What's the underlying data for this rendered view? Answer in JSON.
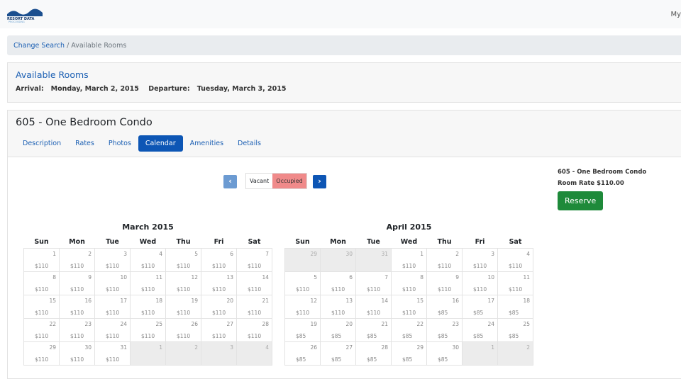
{
  "header": {
    "logo_text": "RESORT DATA PROCESSING",
    "user_menu": "My"
  },
  "breadcrumb": {
    "link": "Change Search",
    "current": "Available Rooms"
  },
  "available": {
    "title": "Available Rooms",
    "arrival_label": "Arrival:",
    "arrival": "Monday, March 2, 2015",
    "departure_label": "Departure:",
    "departure": "Tuesday, March 3, 2015"
  },
  "room": {
    "title": "605 - One Bedroom Condo",
    "tabs": [
      {
        "label": "Description"
      },
      {
        "label": "Rates"
      },
      {
        "label": "Photos"
      },
      {
        "label": "Calendar",
        "active": true
      },
      {
        "label": "Amenities"
      },
      {
        "label": "Details"
      }
    ]
  },
  "legend": {
    "vacant": "Vacant",
    "occupied": "Occupied",
    "occupied_color": "#f08a8a"
  },
  "side": {
    "room": "605 - One Bedroom Condo",
    "rate": "Room Rate $110.00",
    "reserve": "Reserve"
  },
  "weekdays": [
    "Sun",
    "Mon",
    "Tue",
    "Wed",
    "Thu",
    "Fri",
    "Sat"
  ],
  "calendars": [
    {
      "title": "March 2015",
      "weeks": [
        [
          [
            "1",
            "$110"
          ],
          [
            "2",
            "$110"
          ],
          [
            "3",
            "$110"
          ],
          [
            "4",
            "$110"
          ],
          [
            "5",
            "$110"
          ],
          [
            "6",
            "$110"
          ],
          [
            "7",
            "$110"
          ]
        ],
        [
          [
            "8",
            "$110"
          ],
          [
            "9",
            "$110"
          ],
          [
            "10",
            "$110"
          ],
          [
            "11",
            "$110"
          ],
          [
            "12",
            "$110"
          ],
          [
            "13",
            "$110"
          ],
          [
            "14",
            "$110"
          ]
        ],
        [
          [
            "15",
            "$110"
          ],
          [
            "16",
            "$110"
          ],
          [
            "17",
            "$110"
          ],
          [
            "18",
            "$110"
          ],
          [
            "19",
            "$110"
          ],
          [
            "20",
            "$110"
          ],
          [
            "21",
            "$110"
          ]
        ],
        [
          [
            "22",
            "$110"
          ],
          [
            "23",
            "$110"
          ],
          [
            "24",
            "$110"
          ],
          [
            "25",
            "$110"
          ],
          [
            "26",
            "$110"
          ],
          [
            "27",
            "$110"
          ],
          [
            "28",
            "$110"
          ]
        ],
        [
          [
            "29",
            "$110"
          ],
          [
            "30",
            "$110"
          ],
          [
            "31",
            "$110"
          ],
          [
            "1",
            "",
            1
          ],
          [
            "2",
            "",
            1
          ],
          [
            "3",
            "",
            1
          ],
          [
            "4",
            "",
            1
          ]
        ]
      ]
    },
    {
      "title": "April 2015",
      "weeks": [
        [
          [
            "29",
            "",
            1
          ],
          [
            "30",
            "",
            1
          ],
          [
            "31",
            "",
            1
          ],
          [
            "1",
            "$110"
          ],
          [
            "2",
            "$110"
          ],
          [
            "3",
            "$110"
          ],
          [
            "4",
            "$110"
          ]
        ],
        [
          [
            "5",
            "$110"
          ],
          [
            "6",
            "$110"
          ],
          [
            "7",
            "$110"
          ],
          [
            "8",
            "$110"
          ],
          [
            "9",
            "$110"
          ],
          [
            "10",
            "$110"
          ],
          [
            "11",
            "$110"
          ]
        ],
        [
          [
            "12",
            "$110"
          ],
          [
            "13",
            "$110"
          ],
          [
            "14",
            "$110"
          ],
          [
            "15",
            "$110"
          ],
          [
            "16",
            "$85"
          ],
          [
            "17",
            "$85"
          ],
          [
            "18",
            "$85"
          ]
        ],
        [
          [
            "19",
            "$85"
          ],
          [
            "20",
            "$85"
          ],
          [
            "21",
            "$85"
          ],
          [
            "22",
            "$85"
          ],
          [
            "23",
            "$85"
          ],
          [
            "24",
            "$85"
          ],
          [
            "25",
            "$85"
          ]
        ],
        [
          [
            "26",
            "$85"
          ],
          [
            "27",
            "$85"
          ],
          [
            "28",
            "$85"
          ],
          [
            "29",
            "$85"
          ],
          [
            "30",
            "$85"
          ],
          [
            "1",
            "",
            1
          ],
          [
            "2",
            "",
            1
          ]
        ]
      ]
    }
  ]
}
